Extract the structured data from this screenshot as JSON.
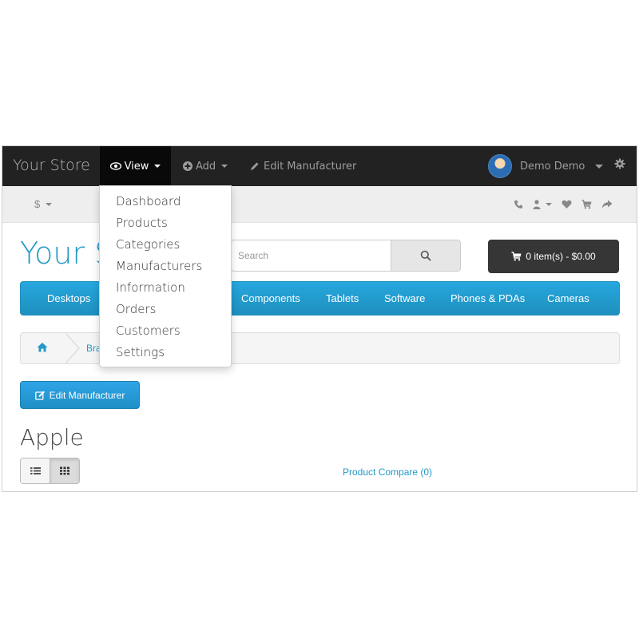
{
  "adminbar": {
    "brand": "Your Store",
    "view_label": "View",
    "add_label": "Add",
    "edit_label": "Edit Manufacturer",
    "user_name": "Demo Demo"
  },
  "topbar": {
    "currency": "$"
  },
  "header": {
    "logo": "Your S",
    "search_placeholder": "Search",
    "cart_label": "0 item(s) - $0.00"
  },
  "menu": {
    "items": [
      "Desktops",
      "Components",
      "Tablets",
      "Software",
      "Phones & PDAs",
      "Cameras"
    ]
  },
  "breadcrumb": {
    "brand_fragment": "Bra"
  },
  "main": {
    "edit_button": "Edit Manufacturer",
    "title": "Apple",
    "compare": "Product Compare (0)"
  },
  "dropdown": {
    "items": [
      "Dashboard",
      "Products",
      "Categories",
      "Manufacturers",
      "Information",
      "Orders",
      "Customers",
      "Settings"
    ]
  },
  "colors": {
    "accent": "#229ac8",
    "adminbar": "#222222",
    "cart": "#363636"
  },
  "icons": [
    "eye-icon",
    "plus-circle-icon",
    "pencil-icon",
    "gear-icon",
    "phone-icon",
    "user-icon",
    "heart-icon",
    "cart-icon",
    "share-icon",
    "search-icon",
    "home-icon",
    "edit-icon",
    "list-icon",
    "grid-icon"
  ]
}
